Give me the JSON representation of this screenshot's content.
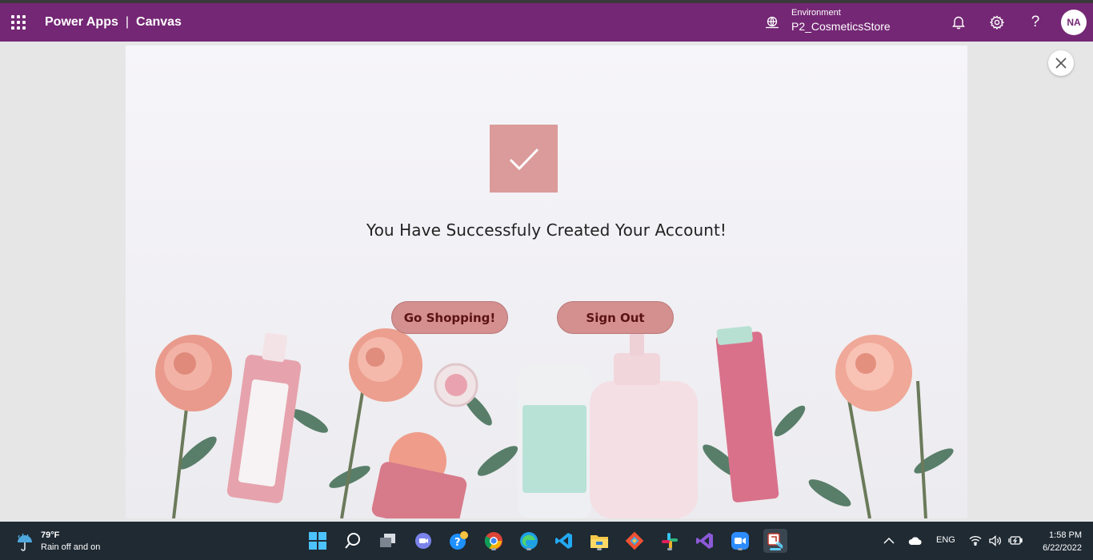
{
  "topbar": {
    "app_name": "Power Apps",
    "separator": "|",
    "app_type": "Canvas",
    "environment_label": "Environment",
    "environment_name": "P2_CosmeticsStore",
    "user_initials": "NA",
    "help_glyph": "?",
    "brand_color": "#742774"
  },
  "canvas": {
    "success_message": "You Have Successfuly Created Your Account!",
    "buttons": {
      "go_shopping": "Go Shopping!",
      "sign_out": "Sign Out"
    },
    "accent_color": "#db9b9b"
  },
  "taskbar": {
    "weather_temp": "79°F",
    "weather_desc": "Rain off and on",
    "language": "ENG",
    "time": "1:58 PM",
    "date": "6/22/2022",
    "apps": [
      "windows-start",
      "search",
      "task-view",
      "teams-chat",
      "help-tips",
      "chrome",
      "edge",
      "vscode",
      "file-explorer",
      "git",
      "slack",
      "visual-studio",
      "zoom",
      "snipping-tool"
    ]
  }
}
